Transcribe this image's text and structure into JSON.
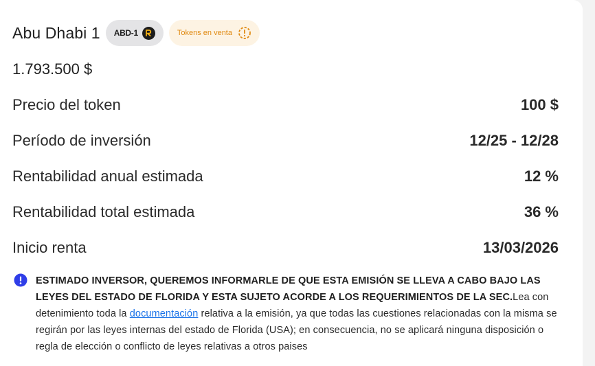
{
  "header": {
    "title": "Abu Dhabi 1",
    "ticker": "ABD-1",
    "ticker_icon": "brand-r-icon",
    "status": "Tokens en venta",
    "status_icon": "alert-timer-icon",
    "status_color": "#e08a12",
    "status_bg": "#fdf3e3"
  },
  "amount": "1.793.500 $",
  "details": [
    {
      "label": "Precio del token",
      "value": "100 $"
    },
    {
      "label": "Período de inversión",
      "value": "12/25 - 12/28"
    },
    {
      "label": "Rentabilidad anual estimada",
      "value": "12 %"
    },
    {
      "label": "Rentabilidad total estimada",
      "value": "36 %"
    },
    {
      "label": "Inicio renta",
      "value": "13/03/2026"
    }
  ],
  "notice": {
    "icon": "info-icon",
    "icon_color": "#2f3ee8",
    "bold_text": "ESTIMADO INVERSOR, QUEREMOS INFORMARLE DE QUE ESTA EMISIÓN SE LLEVA A CABO BAJO LAS LEYES DEL ESTADO DE FLORIDA Y ESTA SUJETO ACORDE A LOS REQUERIMIENTOS DE LA SEC.",
    "text_before_link": "Lea con detenimiento toda la ",
    "link_text": "documentación",
    "text_after_link": " relativa a la emisión, ya que todas las cuestiones relacionadas con la misma se regirán por las leyes internas del estado de Florida (USA); en consecuencia, no se aplicará ninguna disposición o regla de elección o conflicto de leyes relativas a otros paises",
    "link_color": "#1a73e8"
  }
}
